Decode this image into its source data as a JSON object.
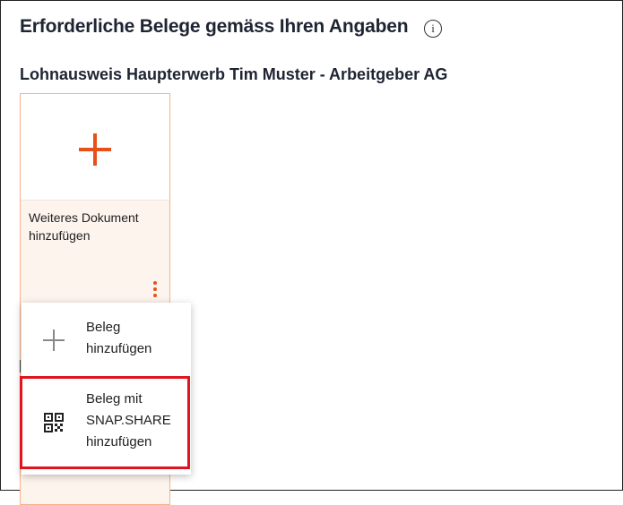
{
  "header": {
    "title": "Erforderliche Belege gemäss Ihren Angaben",
    "info_icon": "info-icon",
    "info_glyph": "i"
  },
  "section": {
    "title": "Lohnausweis Haupterwerb Tim Muster - Arbeitgeber AG"
  },
  "card": {
    "label_line1": "Weiteres Dokument",
    "label_line2": "hinzufügen",
    "add_icon": "plus-icon",
    "more_icon": "kebab-menu-icon"
  },
  "menu": {
    "items": [
      {
        "lines": [
          "Beleg",
          "hinzufügen"
        ],
        "icon": "plus-icon"
      },
      {
        "lines": [
          "Beleg mit",
          "SNAP.SHARE",
          "hinzufügen"
        ],
        "icon": "qr-code-icon",
        "highlighted": true
      }
    ]
  },
  "colors": {
    "accent": "#e8501a",
    "card_border": "#f6b28c",
    "card_bg": "#fdf4ee",
    "highlight": "#e0141e"
  }
}
